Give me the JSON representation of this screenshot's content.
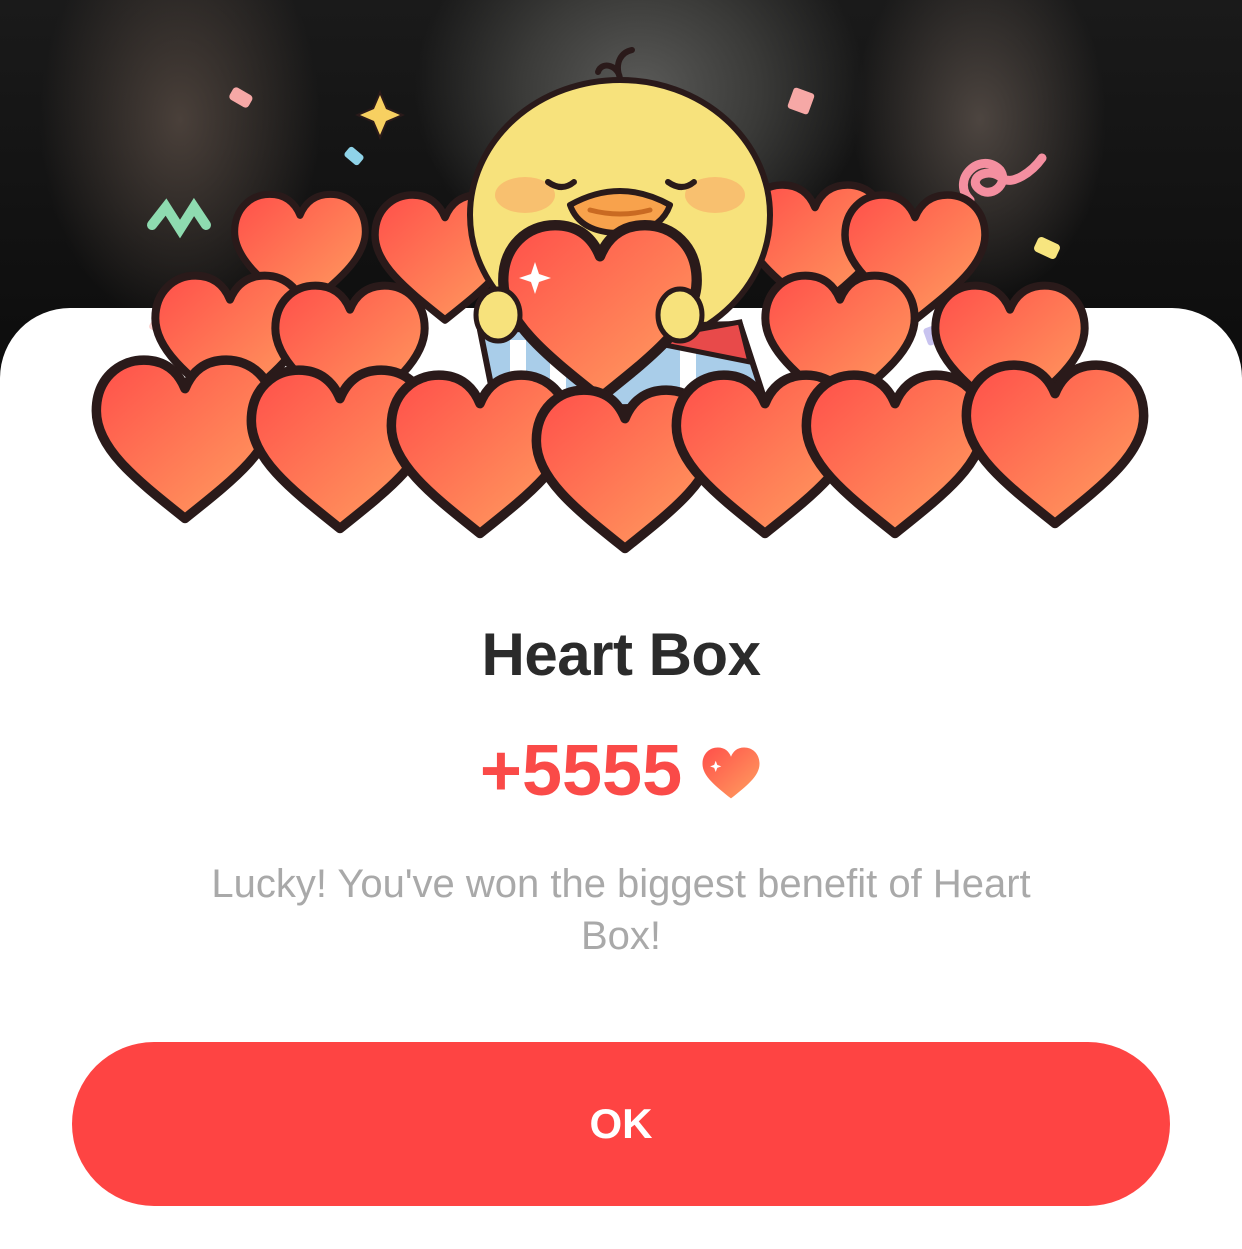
{
  "dialog": {
    "title": "Heart Box",
    "reward_amount": "+5555",
    "reward_icon": "heart-icon",
    "message": "Lucky! You've won the biggest benefit of Heart Box!",
    "ok_label": "OK"
  },
  "colors": {
    "accent": "#fe4443",
    "heart_top": "#ff5b52",
    "heart_bottom": "#ff9a5c",
    "title": "#2b2b2b",
    "message": "#a9a9a9"
  },
  "illustration": {
    "subject": "chick-holding-heart-with-heart-pile",
    "decor": "confetti"
  }
}
